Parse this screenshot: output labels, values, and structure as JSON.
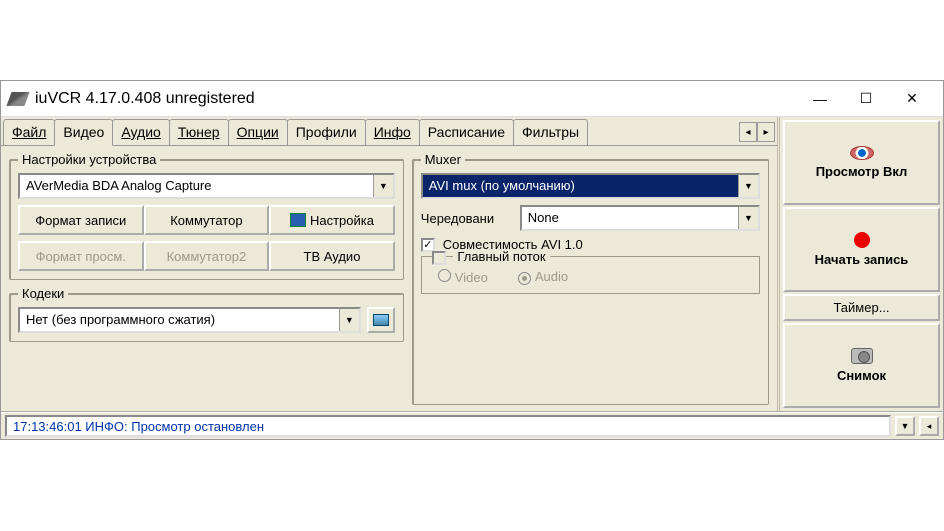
{
  "window": {
    "title": "iuVCR 4.17.0.408 unregistered"
  },
  "tabs": {
    "file": "Файл",
    "video": "Видео",
    "audio": "Аудио",
    "tuner": "Тюнер",
    "options": "Опции",
    "profiles": "Профили",
    "info": "Инфо",
    "schedule": "Расписание",
    "filters": "Фильтры"
  },
  "device": {
    "legend": "Настройки устройства",
    "selected": "AVerMedia BDA Analog Capture",
    "btn_rec_format": "Формат записи",
    "btn_commutator": "Коммутатор",
    "btn_settings": "Настройка",
    "btn_view_format": "Формат просм.",
    "btn_commutator2": "Коммутатор2",
    "btn_tv_audio": "ТВ Аудио"
  },
  "codecs": {
    "legend": "Кодеки",
    "selected": "Нет (без программного сжатия)"
  },
  "muxer": {
    "legend": "Muxer",
    "selected": "AVI mux (по умолчанию)",
    "interleave_label": "Чередовани",
    "interleave_value": "None",
    "avi_compat": "Совместимость AVI 1.0",
    "main_stream": "Главный поток",
    "radio_video": "Video",
    "radio_audio": "Audio"
  },
  "side": {
    "preview": "Просмотр Вкл",
    "record": "Начать запись",
    "timer": "Таймер...",
    "snapshot": "Снимок"
  },
  "status": {
    "text": "17:13:46:01 ИНФО: Просмотр остановлен"
  }
}
